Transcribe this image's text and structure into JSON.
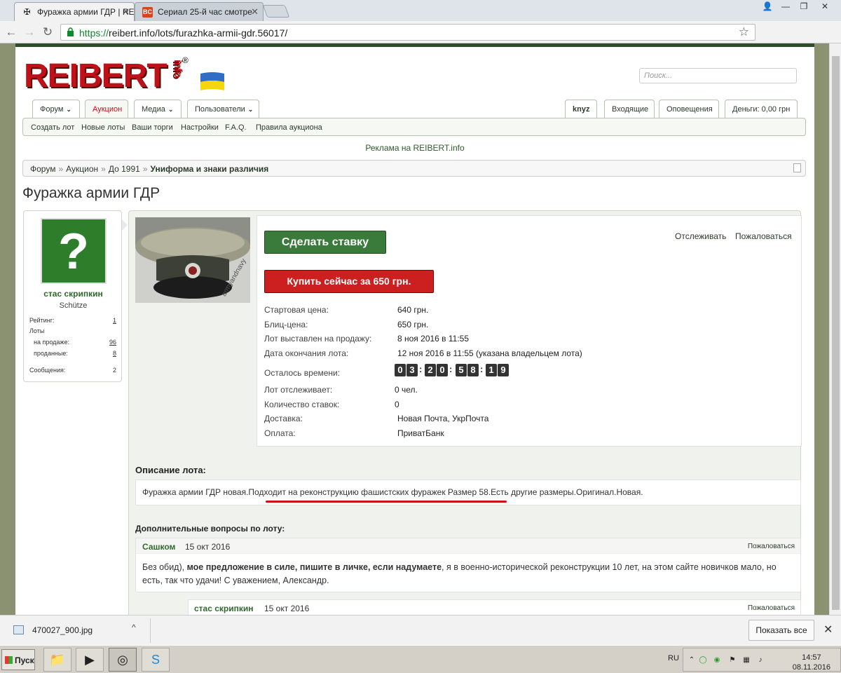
{
  "browser": {
    "tabs": [
      {
        "title": "Фуражка армии ГДР | RE"
      },
      {
        "title": "Сериал 25-й час смотре"
      }
    ],
    "url_scheme": "https://",
    "url_rest": "reibert.info/lots/furazhka-armii-gdr.56017/"
  },
  "site": {
    "logo_text": "REIBERT",
    "logo_suffix": "info",
    "logo_reg": "®",
    "search_placeholder": "Поиск...",
    "nav_left": [
      {
        "label": "Форум",
        "dropdown": true
      },
      {
        "label": "Аукцион",
        "dropdown": false
      },
      {
        "label": "Медиа",
        "dropdown": true
      },
      {
        "label": "Пользователи",
        "dropdown": true
      }
    ],
    "nav_right": [
      "knyz",
      "Входящие",
      "Оповещения",
      "Деньги: 0,00 грн"
    ],
    "subnav": [
      "Создать лот",
      "Новые лоты",
      "Ваши торги",
      "Настройки",
      "F.A.Q.",
      "Правила аукциона"
    ],
    "ad_text": "Реклама на REIBERT.info",
    "breadcrumb": [
      "Форум",
      "Аукцион",
      "До 1991",
      "Униформа и знаки различия"
    ],
    "breadcrumb_sep": "»",
    "page_title": "Фуражка армии ГДР"
  },
  "seller": {
    "name": "стас скрипкин",
    "title": "Schütze",
    "rating_label": "Рейтинг:",
    "rating": "1",
    "lots_label": "Лоты",
    "on_sale_label": "на продаже:",
    "on_sale": "96",
    "sold_label": "проданные:",
    "sold": "8",
    "messages_label": "Сообщения:",
    "messages": "2",
    "avatar_glyph": "?"
  },
  "lot": {
    "watermark": "armyandnavy",
    "bid_button": "Сделать ставку",
    "buy_button": "Купить сейчас за 650 грн.",
    "watch_link": "Отслеживать",
    "report_link": "Пожаловаться",
    "fields": [
      {
        "label": "Стартовая цена:",
        "value": "640 грн."
      },
      {
        "label": "Блиц-цена:",
        "value": "650 грн."
      },
      {
        "label": "Лот выставлен на продажу:",
        "value": "8 ноя 2016 в 11:55"
      },
      {
        "label": "Дата окончания лота:",
        "value": "12 ноя 2016 в 11:55 (указана владельцем лота)"
      }
    ],
    "time_left_label": "Осталось времени:",
    "countdown": [
      "0",
      "3",
      "2",
      "0",
      "5",
      "8",
      "1",
      "9"
    ],
    "fields2": [
      {
        "label": "Лот отслеживает:",
        "value": "0 чел."
      },
      {
        "label": "Количество ставок:",
        "value": "0"
      },
      {
        "label": "Доставка:",
        "value": "Новая Почта, УкрПочта"
      },
      {
        "label": "Оплата:",
        "value": "ПриватБанк"
      }
    ],
    "description_heading": "Описание лота:",
    "description": "Фуражка армии ГДР новая.Подходит на реконструкцию фашистских фуражек Размер 58.Есть другие размеры.Оригинал.Новая.",
    "questions_heading": "Дополнительные вопросы по лоту:",
    "questions": [
      {
        "author": "Сашком",
        "date": "15 окт 2016",
        "report": "Пожаловаться",
        "text_pre": "Без обид), ",
        "text_bold": "мое предложение в силе, пишите в личке, если надумаете",
        "text_post": ", я в военно-исторической реконструкции 10 лет, на этом сайте новичков мало, но есть, так что удачи! С уважением, Александр."
      },
      {
        "author": "стас скрипкин",
        "date": "15 окт 2016",
        "report": "Пожаловаться"
      }
    ]
  },
  "downloads": {
    "file": "470027_900.jpg",
    "show_all": "Показать все"
  },
  "taskbar": {
    "start": "Пуск",
    "lang": "RU",
    "time": "14:57",
    "date": "08.11.2016"
  }
}
